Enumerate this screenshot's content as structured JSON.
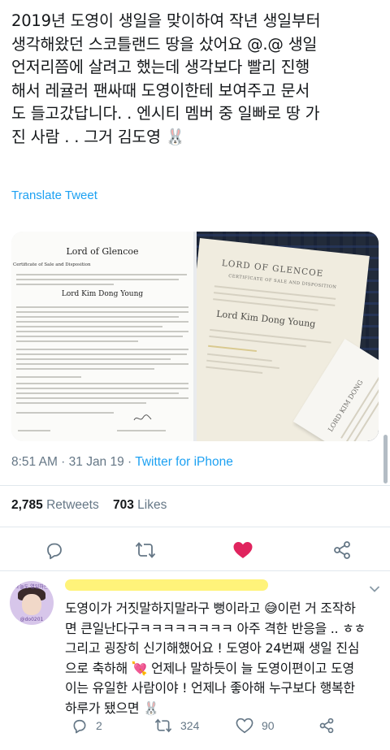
{
  "tweet": {
    "text": "2019년 도영이 생일을 맞이하여 작년 생일부터\n생각해왔던 스코틀랜드 땅을 샀어요 @.@ 생일\n언저리쯤에 살려고 했는데 생각보다 빨리 진행\n해서 레귤러 팬싸때 도영이한테 보여주고 문서\n도 들고갔답니다. . 엔시티 멤버 중 일빠로 땅 가\n진 사람 . . 그거 김도영 🐰",
    "translate_label": "Translate Tweet",
    "time": "8:51 AM · 31 Jan 19 · ",
    "source": "Twitter for iPhone",
    "retweets_count": "2,785",
    "retweets_label": "Retweets",
    "likes_count": "703",
    "likes_label": "Likes"
  },
  "media": {
    "left_doc": {
      "title": "Lord of Glencoe",
      "subtitle": "Certificate of Sale and Disposition",
      "name": "Lord Kim Dong Young"
    },
    "right_doc": {
      "title": "LORD OF GLENCOE",
      "subtitle": "CERTIFICATE OF SALE AND DISPOSITION",
      "name": "Lord Kim Dong Young",
      "card_name": "LORD KIM DONG"
    }
  },
  "reply": {
    "avatar_top_text": "오늘도 열일하는",
    "avatar_bottom_text": "@do0201",
    "text": "도영이가 거짓말하지말라구 뻥이라고 😅이런 거 조작하\n면 큰일난다구ㅋㅋㅋㅋㅋㅋㅋㅋ 아주 격한 반응을 .. ㅎㅎ\n그리고 굉장히 신기해했어요 ! 도영아 24번째 생일 진심\n으로 축하해 💘 언제나 말하듯이 늘 도영이편이고 도영\n이는 유일한 사람이야 ! 언제나 좋아해 누구보다 행복한\n하루가 됐으면 🐰",
    "reply_count": "2",
    "retweet_count": "324",
    "like_count": "90"
  },
  "colors": {
    "accent": "#1da1f2",
    "like": "#e0245e",
    "muted": "#657786",
    "highlight": "#fff37a"
  },
  "icons": {
    "reply": "reply-icon",
    "retweet": "retweet-icon",
    "like": "heart-icon",
    "share": "share-icon",
    "more": "chevron-down-icon"
  }
}
